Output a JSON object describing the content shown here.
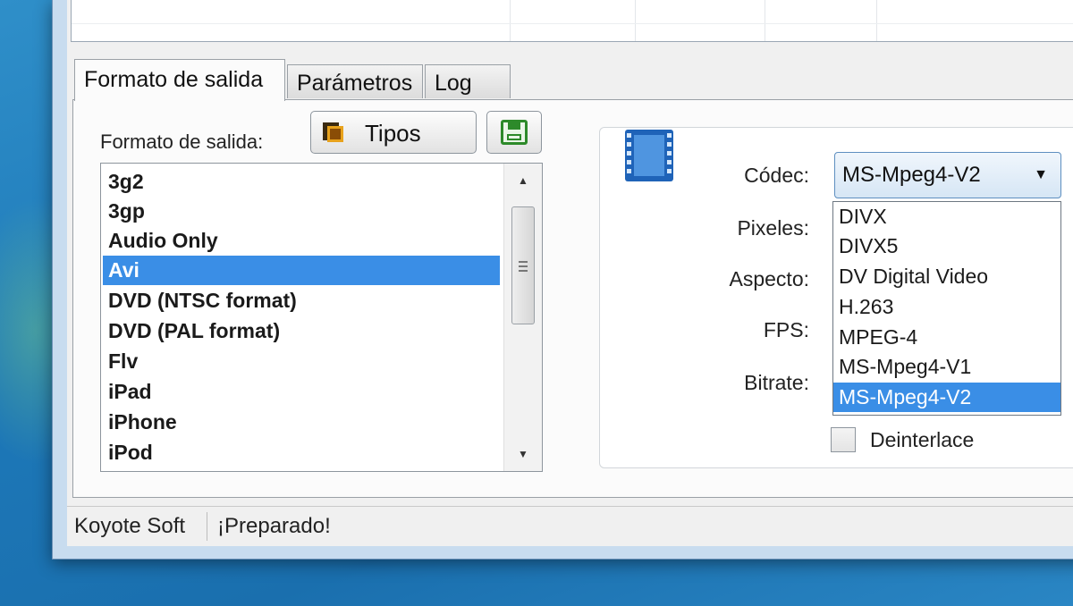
{
  "tabs": [
    {
      "label": "Formato de salida",
      "active": true
    },
    {
      "label": "Parámetros",
      "active": false
    },
    {
      "label": "Log",
      "active": false
    }
  ],
  "output": {
    "label": "Formato de salida:",
    "tipos_button": "Tipos",
    "tipos_icon": "film-type-icon",
    "save_icon": "floppy-save-icon"
  },
  "formats": {
    "items": [
      "3g2",
      "3gp",
      "Audio Only",
      "Avi",
      "DVD (NTSC format)",
      "DVD (PAL format)",
      "Flv",
      "iPad",
      "iPhone",
      "iPod"
    ],
    "selected": "Avi",
    "selection_color": "#3a8ee6"
  },
  "settings": {
    "icon": "film-strip-icon",
    "codec_label": "Códec:",
    "codec_value": "MS-Mpeg4-V2",
    "pixels_label": "Pixeles:",
    "aspect_label": "Aspecto:",
    "fps_label": "FPS:",
    "bitrate_label": "Bitrate:",
    "codec_options": [
      "DIVX",
      "DIVX5",
      "DV Digital Video",
      "H.263",
      "MPEG-4",
      "MS-Mpeg4-V1",
      "MS-Mpeg4-V2"
    ],
    "codec_selected": "MS-Mpeg4-V2",
    "deinterlace_label": "Deinterlace",
    "deinterlace_checked": false
  },
  "status": {
    "company": "Koyote Soft",
    "message": "¡Preparado!"
  }
}
